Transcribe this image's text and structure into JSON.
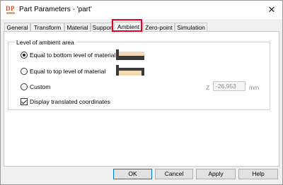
{
  "window": {
    "title": "Part Parameters - 'part'",
    "close_glyph": "✕",
    "app_icon": "dp-app-icon"
  },
  "tabs": [
    {
      "label": "General",
      "active": false
    },
    {
      "label": "Transform",
      "active": false
    },
    {
      "label": "Material",
      "active": false
    },
    {
      "label": "Support",
      "active": false
    },
    {
      "label": "Ambient",
      "active": true
    },
    {
      "label": "Zero-point",
      "active": false
    },
    {
      "label": "Simulation",
      "active": false
    }
  ],
  "ambient": {
    "group_title": "Level of ambient area",
    "options": [
      {
        "label": "Equal to bottom level of material",
        "checked": true,
        "icon": "bottom-level-icon"
      },
      {
        "label": "Equal to top level of material",
        "checked": false,
        "icon": "top-level-icon"
      },
      {
        "label": "Custom",
        "checked": false
      }
    ],
    "z_label": "Z",
    "z_value": "-26.953",
    "unit": "mm",
    "display_translated": {
      "label": "Display translated coordinates",
      "checked": true
    }
  },
  "buttons": {
    "ok": "OK",
    "cancel": "Cancel",
    "apply": "Apply",
    "help": "Help"
  },
  "colors": {
    "highlight": "#e0001b",
    "material": "#f3d9b8",
    "dark": "#3a3a3a"
  }
}
